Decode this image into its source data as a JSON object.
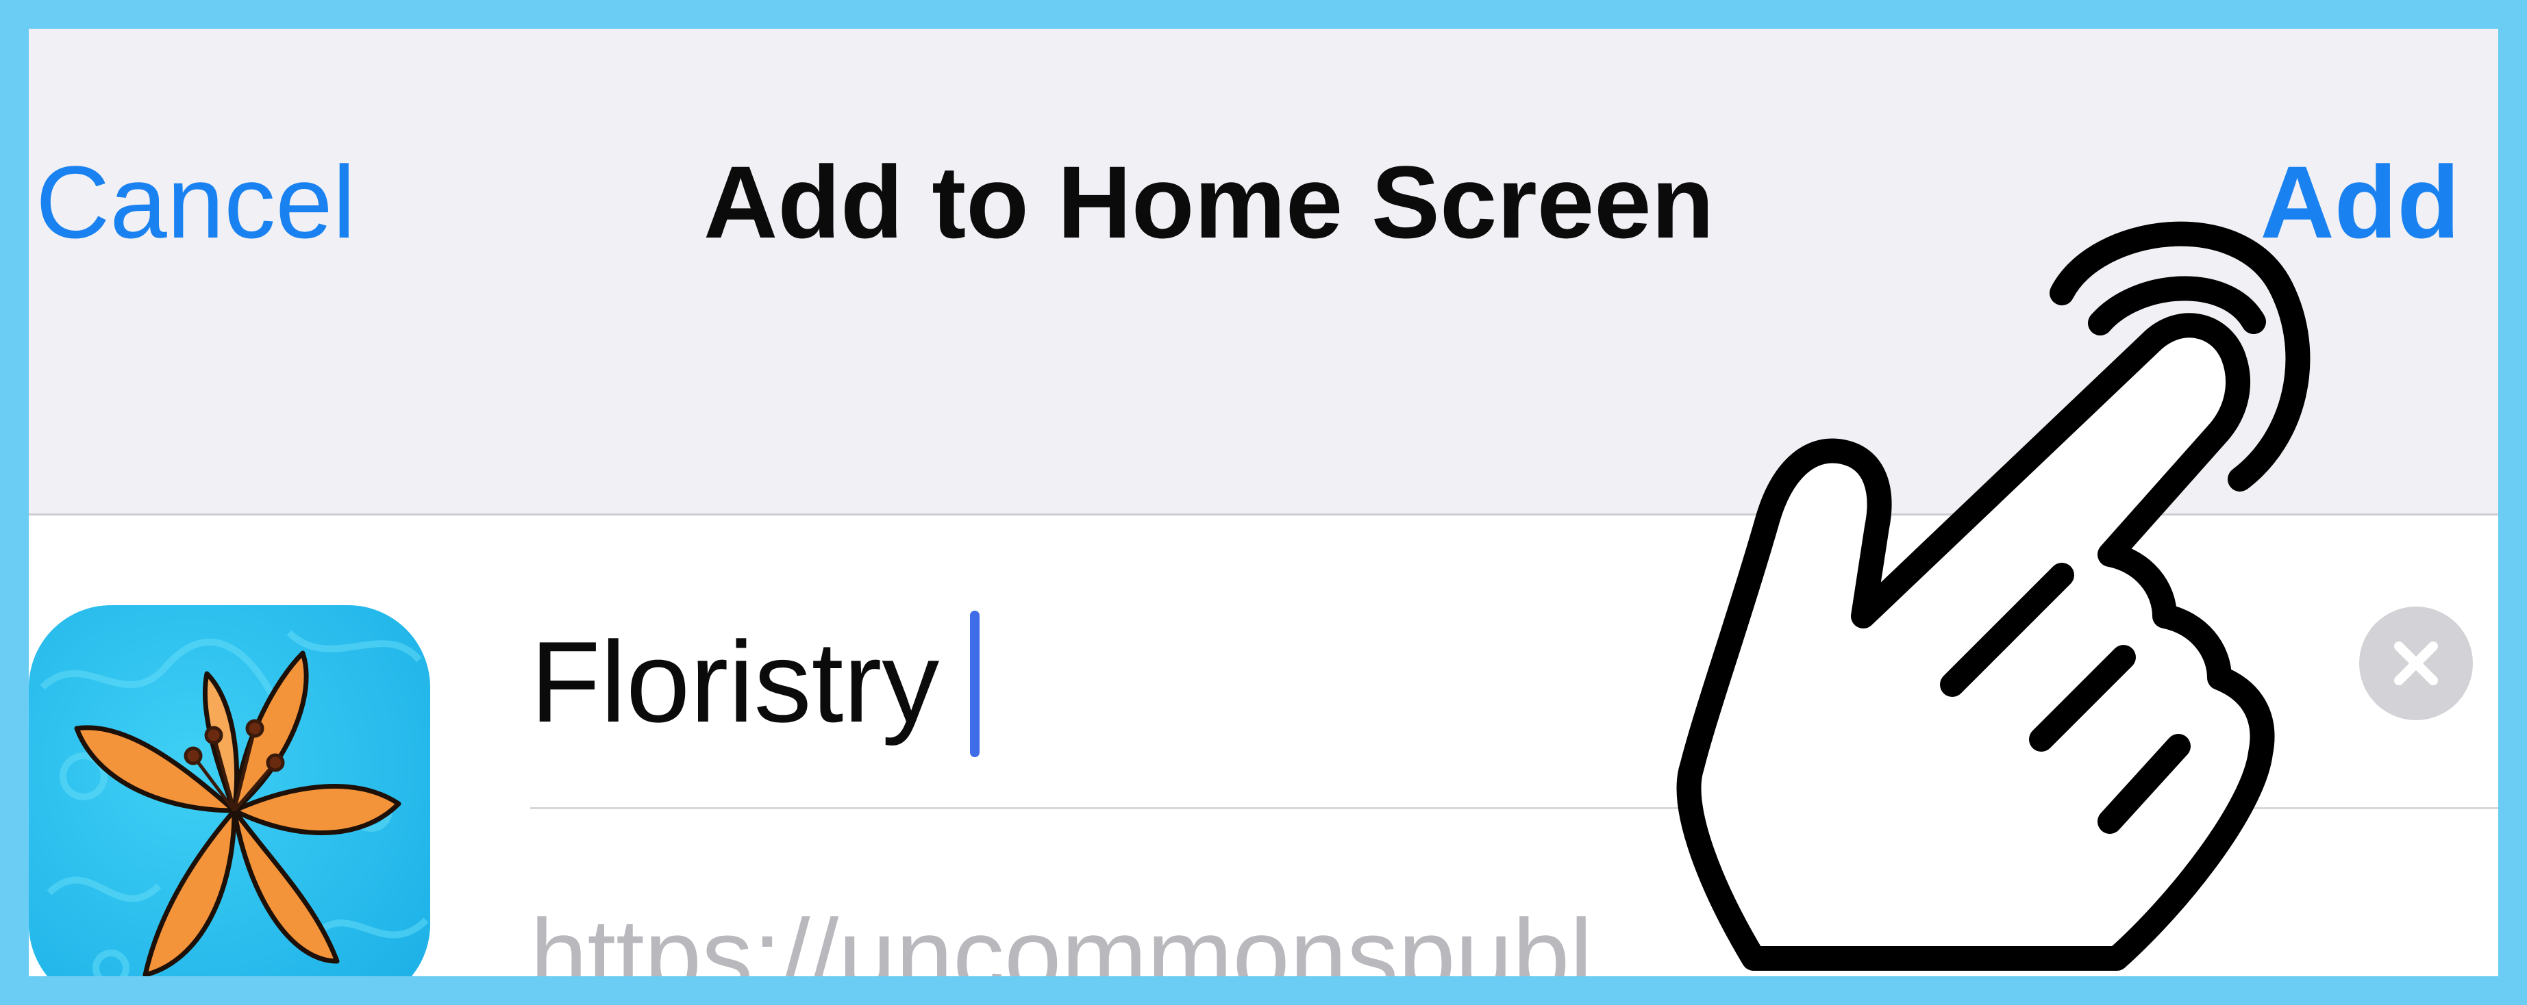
{
  "nav": {
    "cancel_label": "Cancel",
    "title": "Add to Home Screen",
    "add_label": "Add"
  },
  "form": {
    "name_value": "Floristry",
    "url_text": "https://uncommonspubl"
  },
  "icons": {
    "app_icon": "lily-flower-icon",
    "clear_icon": "clear-x-icon",
    "gesture_icon": "tap-hand-icon"
  },
  "colors": {
    "accent": "#1a82f0",
    "frame": "#6ccdf4",
    "nav_background": "#f1f1f5",
    "caret": "#3e6de7"
  }
}
